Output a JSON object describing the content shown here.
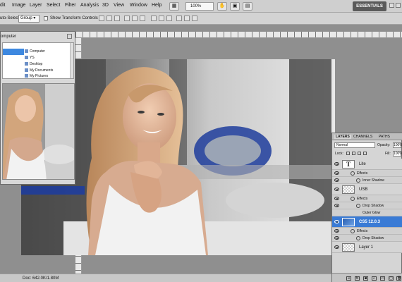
{
  "menubar": {
    "items": [
      "dit",
      "Image",
      "Layer",
      "Select",
      "Filter",
      "Analysis",
      "3D",
      "View",
      "Window",
      "Help"
    ],
    "zoom": "100%",
    "workspace": "ESSENTIALS"
  },
  "options": {
    "auto_select_label": "uto-Select:",
    "auto_select_value": "Group",
    "transform_label": "Show Transform Controls"
  },
  "float_window": {
    "title": "omputer",
    "items": [
      "Computer",
      "YS",
      "Desktop",
      "My Documents",
      "My Pictures"
    ]
  },
  "layers_panel": {
    "tabs": [
      "LAYERS",
      "CHANNELS",
      "PATHS"
    ],
    "blend_mode": "Normal",
    "opacity_label": "Opacity:",
    "opacity_value": "100%",
    "lock_label": "Lock:",
    "fill_label": "Fill:",
    "fill_value": "100%",
    "layers": [
      {
        "name": "Lite",
        "thumb": "T",
        "effects_label": "Effects",
        "effects": [
          "Inner Shadow"
        ]
      },
      {
        "name": "USB",
        "effects_label": "Effects",
        "effects": [
          "Drop Shadow",
          "Outer Glow"
        ]
      },
      {
        "name": "CS5 12.0.3",
        "effects_label": "Effects",
        "effects": [
          "Drop Shadow"
        ]
      },
      {
        "name": "Layer 1"
      }
    ]
  },
  "status": {
    "doc": "Doc: 642.0K/1.80M"
  },
  "colors": {
    "selection": "#3a7bd5",
    "chrome": "#d3d3d3",
    "canvas_bg": "#8f8f8f",
    "workspace_button": "#5a5a5a"
  }
}
